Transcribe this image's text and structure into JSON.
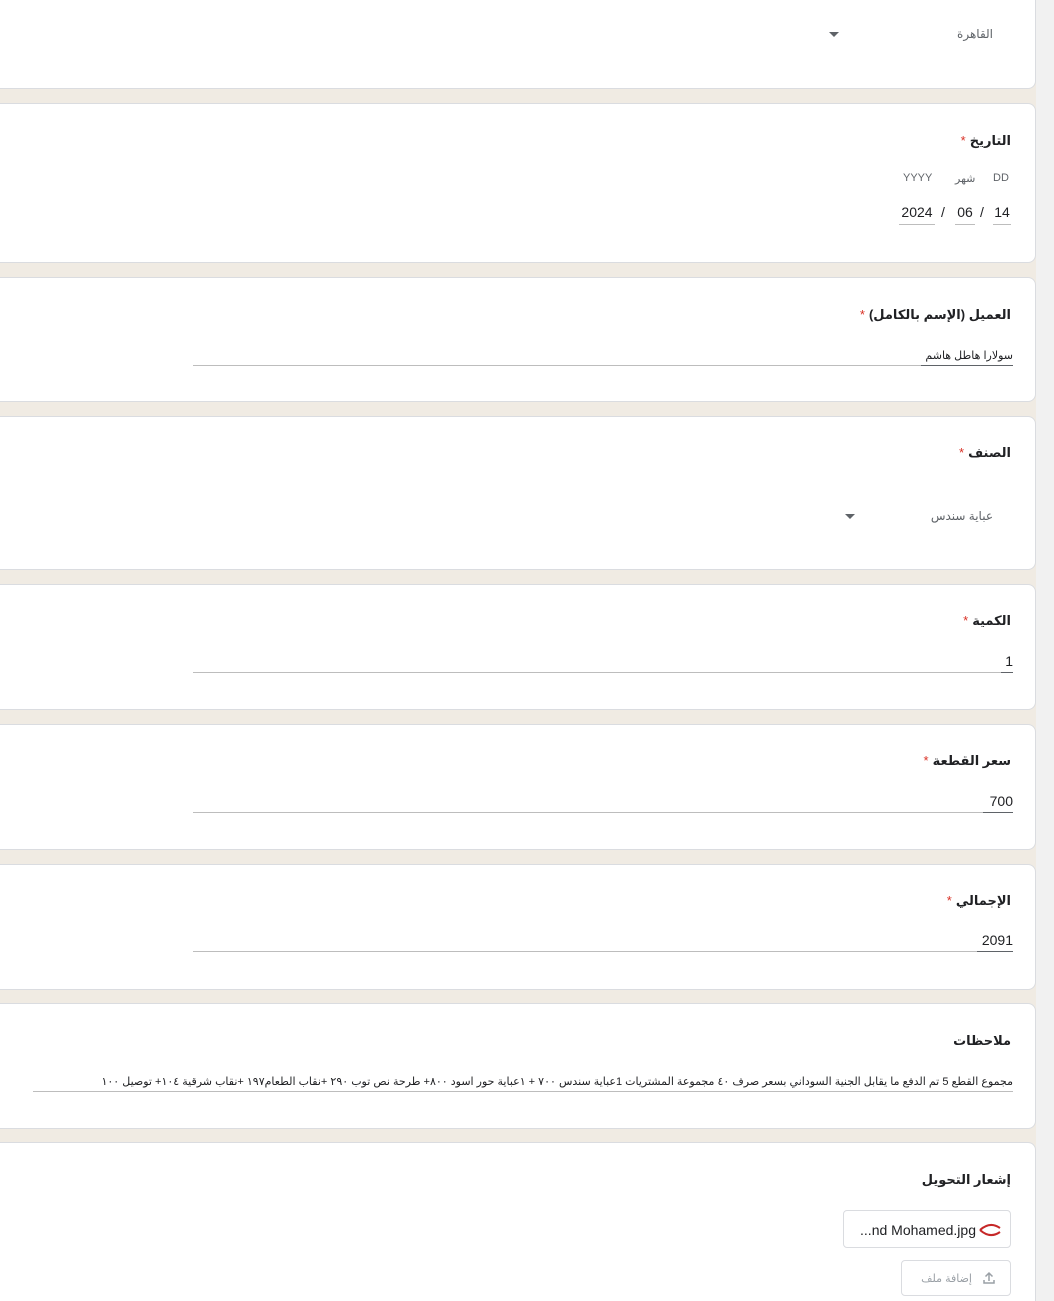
{
  "city": {
    "selected": "القاهرة"
  },
  "date": {
    "title": "التاريخ",
    "required_mark": "*",
    "labels": {
      "day": "DD",
      "month": "شهر",
      "year": "YYYY"
    },
    "day": "14",
    "month": "06",
    "year": "2024",
    "separator": "/"
  },
  "client": {
    "title": "العميل (الإسم بالكامل)",
    "required_mark": "*",
    "value": "سولارا هاطل هاشم"
  },
  "category": {
    "title": "الصنف",
    "required_mark": "*",
    "selected": "عباية سندس"
  },
  "quantity": {
    "title": "الكمية",
    "required_mark": "*",
    "value": "1"
  },
  "unit_price": {
    "title": "سعر القطعة",
    "required_mark": "*",
    "value": "700"
  },
  "total": {
    "title": "الإجمالي",
    "required_mark": "*",
    "value": "2091"
  },
  "notes": {
    "title": "ملاحظات",
    "value": "مجموع القطع 5 تم الدفع ما يقابل الجنية السوداني بسعر صرف ٤٠ مجموعة المشتريات 1عباية سندس ٧٠٠ + ١عباية حور اسود ٨٠٠+ طرحة نص توب ٢٩٠ +نقاب الطعام١٩٧ +نقاب شرقية ١٠٤+ توصيل ١٠٠"
  },
  "transfer": {
    "title": "إشعار التحويل",
    "file_name": "...nd Mohamed.jpg",
    "add_file_label": "إضافة ملف"
  }
}
